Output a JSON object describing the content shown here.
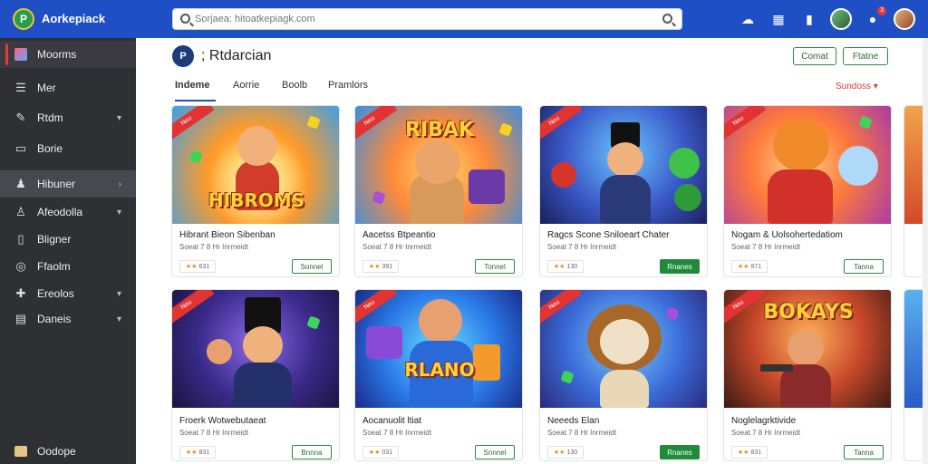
{
  "app": {
    "title": "Aorkepiack",
    "logo_letter": "P"
  },
  "search": {
    "placeholder": "Sorjaea: hitoatkepiagk.com"
  },
  "topbar": {
    "notification_count": "3"
  },
  "sidebar": {
    "items": [
      {
        "label": "Moorms",
        "icon": "apps-icon",
        "chevron": false
      },
      {
        "label": "Mer",
        "icon": "list-icon",
        "chevron": false
      },
      {
        "label": "Rtdm",
        "icon": "tools-icon",
        "chevron": true
      },
      {
        "label": "Borie",
        "icon": "tv-icon",
        "chevron": false
      },
      {
        "label": "Hibuner",
        "icon": "user-icon",
        "chevron": true
      },
      {
        "label": "Afeodolla",
        "icon": "person-icon",
        "chevron": true
      },
      {
        "label": "Bligner",
        "icon": "file-icon",
        "chevron": false
      },
      {
        "label": "Ffaolm",
        "icon": "globe-icon",
        "chevron": false
      },
      {
        "label": "Ereolos",
        "icon": "gamepad-icon",
        "chevron": true
      },
      {
        "label": "Daneis",
        "icon": "grid-icon",
        "chevron": true
      }
    ],
    "footer_label": "Oodope"
  },
  "page": {
    "logo_letter": "P",
    "title": "; Rtdarcian",
    "buttons": {
      "primary": "Comat",
      "secondary": "Ftatne"
    },
    "tabs": [
      "Indeme",
      "Aorrie",
      "Boolb",
      "Pramlors"
    ],
    "sort_label": "Sundoss"
  },
  "cards": [
    {
      "ribbon": "Neu",
      "logo_text": "HIBROMS",
      "title": "Hibrant Bieon Sibenban",
      "subtitle": "Soeat 7 8 Hr Inrmeidt",
      "rating": "631",
      "install": "Sonnel",
      "install_filled": false
    },
    {
      "ribbon": "Neu",
      "logo_text": "RIBAK",
      "title": "Aacetss Btpeantio",
      "subtitle": "Soeat 7 8 Hr Inrmeidt",
      "rating": "391",
      "install": "Tonnel",
      "install_filled": false
    },
    {
      "ribbon": "Neu",
      "logo_text": "",
      "title": "Ragcs Scone Sniloeart Chater",
      "subtitle": "Soeat 7 8 Hr Inrmeidt",
      "rating": "130",
      "install": "Rnanes",
      "install_filled": true
    },
    {
      "ribbon": "Neu",
      "logo_text": "",
      "title": "Nogam & Uolsohertedatiom",
      "subtitle": "Soeat 7 8 Hr Inrmeidt",
      "rating": "871",
      "install": "Tanna",
      "install_filled": false
    },
    {
      "ribbon": "Neu",
      "logo_text": "",
      "title": "Froerk Wotwebutaeat",
      "subtitle": "Soeat 7 8 Hr Inrmeidt",
      "rating": "831",
      "install": "Bnnna",
      "install_filled": false
    },
    {
      "ribbon": "Neu",
      "logo_text": "RLANO",
      "title": "Aocanuolit ltiat",
      "subtitle": "Soeat 7 8 Hr Inrmeidt",
      "rating": "031",
      "install": "Snnnel",
      "install_filled": false
    },
    {
      "ribbon": "Neu",
      "logo_text": "",
      "title": "Neeeds Elan",
      "subtitle": "Soeat 7 8 Hr Inrmeidt",
      "rating": "130",
      "install": "Rnanes",
      "install_filled": true
    },
    {
      "ribbon": "Neu",
      "logo_text": "BOKAYS",
      "title": "Noglelagrktivide",
      "subtitle": "Soeat 7 8 Hr Inrmeidt",
      "rating": "831",
      "install": "Tanna",
      "install_filled": false
    }
  ]
}
